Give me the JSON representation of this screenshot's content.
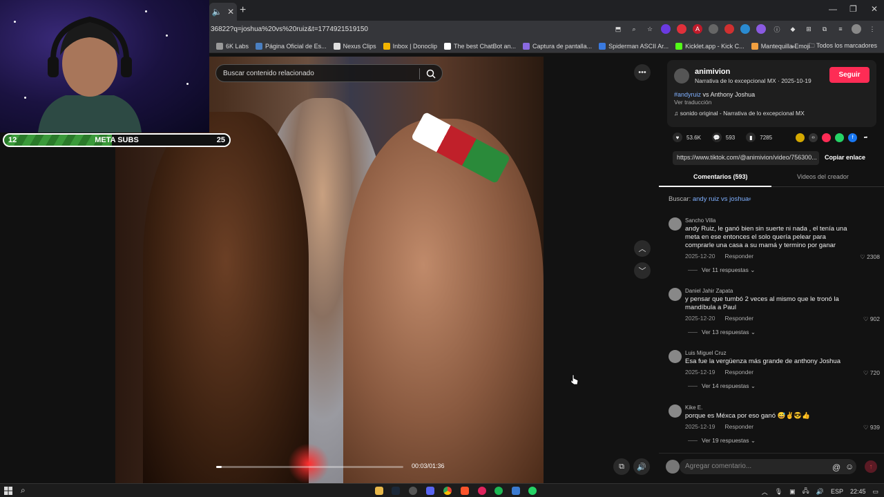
{
  "webcam": {
    "meta_bar": {
      "left": "12",
      "label": "META SUBS",
      "right": "25",
      "progress": 0.48
    }
  },
  "browser": {
    "tab_close": "✕",
    "url": "36822?q=joshua%20vs%20ruiz&t=1774921519150",
    "bookmarks": [
      {
        "label": "6K Labs",
        "color": "#999"
      },
      {
        "label": "Página Oficial de Es...",
        "color": "#4a7fc1"
      },
      {
        "label": "Nexus Clips",
        "color": "#e0e0e0"
      },
      {
        "label": "Inbox | Donoclip",
        "color": "#f2b400"
      },
      {
        "label": "The best ChatBot an...",
        "color": "#fff"
      },
      {
        "label": "Captura de pantalla...",
        "color": "#8a6ae0"
      },
      {
        "label": "Spiderman ASCII Ar...",
        "color": "#3a7ae0"
      },
      {
        "label": "Kicklet.app - Kick C...",
        "color": "#53fc18"
      },
      {
        "label": "Mantequilla Emoji",
        "color": "#f2a040"
      }
    ],
    "bookmarks_overflow": "»",
    "all_bookmarks": "Todos los marcadores"
  },
  "video": {
    "search_placeholder": "Buscar contenido relacionado",
    "time": "00:03/01:36",
    "progress": 0.031
  },
  "panel": {
    "author": "animivion",
    "subtitle": "Narrativa de lo excepcional MX · 2025-10-19",
    "follow": "Seguir",
    "hashtag": "#andyruiz",
    "caption_rest": " vs Anthony Joshua",
    "translate": "Ver traducción",
    "sound": "sonido original - Narrativa de lo excepcional MX",
    "likes": "53.6K",
    "comments_count": "593",
    "saves": "7285",
    "link": "https://www.tiktok.com/@animivion/video/756300...",
    "copy": "Copiar enlace",
    "tab_comments": "Comentarios (593)",
    "tab_creator": "Videos del creador",
    "search_prefix": "Buscar:",
    "search_query": "andy ruiz vs joshua",
    "comments": [
      {
        "name": "Sancho Villa",
        "text": "andy Ruiz, le ganó bien sin suerte ni nada , el tenía una meta en ese entonces el solo quería pelear para comprarle una casa a su mamá y termino por ganar",
        "date": "2025-12-20",
        "reply": "Responder",
        "likes": "2308",
        "replies": "Ver 11 respuestas ⌄"
      },
      {
        "name": "Daniel Jahir Zapata",
        "text": "y pensar que tumbó 2 veces al mismo que le tronó la mandíbula a Paul",
        "date": "2025-12-20",
        "reply": "Responder",
        "likes": "902",
        "replies": "Ver 13 respuestas ⌄"
      },
      {
        "name": "Luis Miguel Cruz",
        "text": "Esa fue la vergüenza más grande de anthony Joshua",
        "date": "2025-12-19",
        "reply": "Responder",
        "likes": "720",
        "replies": "Ver 14 respuestas ⌄"
      },
      {
        "name": "Kike E.",
        "text": "porque es Méxca por eso ganó 😅✌️😎👍",
        "date": "2025-12-19",
        "reply": "Responder",
        "likes": "939",
        "replies": "Ver 19 respuestas ⌄"
      }
    ],
    "comment_placeholder": "Agregar comentario..."
  },
  "taskbar": {
    "lang": "ESP",
    "time": "22:45"
  }
}
